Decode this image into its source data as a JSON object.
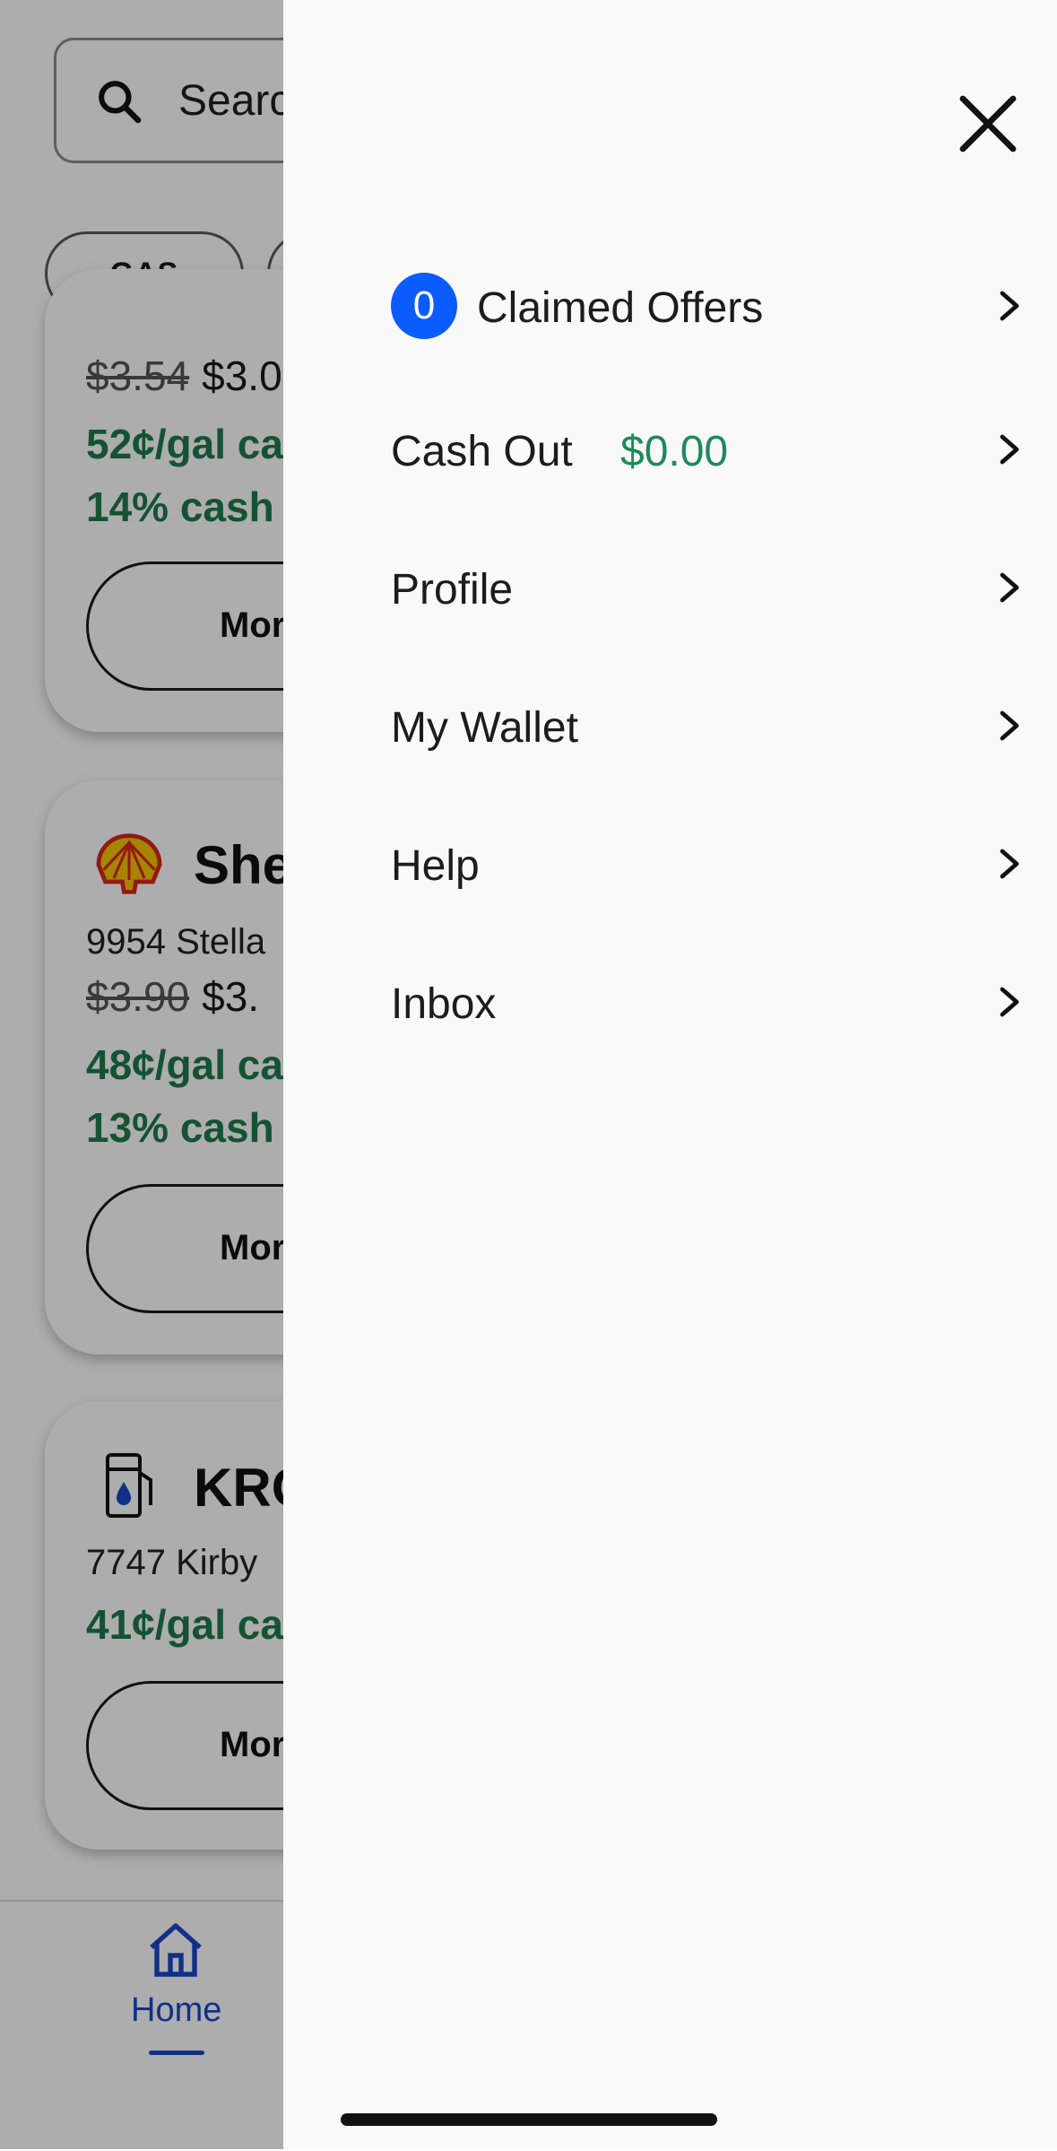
{
  "background": {
    "search": {
      "placeholder": "Search"
    },
    "chips": [
      {
        "label": "GAS"
      }
    ],
    "cards": [
      {
        "old_price": "$3.54",
        "new_price": "$3.0",
        "cashback_line1": "52¢/gal ca",
        "cashback_line2": "14% cash",
        "button_label": "Mor"
      },
      {
        "name": "She",
        "address": "9954 Stella",
        "old_price": "$3.90",
        "new_price": "$3.",
        "cashback_line1": "48¢/gal ca",
        "cashback_line2": "13% cash",
        "button_label": "Mor"
      },
      {
        "name": "KRO",
        "address": "7747 Kirby",
        "cashback_line1": "41¢/gal ca",
        "button_label": "Mor"
      }
    ],
    "bottom_nav": {
      "home_label": "Home"
    }
  },
  "drawer": {
    "claimed_offers_count": "0",
    "items": [
      {
        "label": "Claimed Offers"
      },
      {
        "label": "Cash Out",
        "amount": "$0.00"
      },
      {
        "label": "Profile"
      },
      {
        "label": "My Wallet"
      },
      {
        "label": "Help"
      },
      {
        "label": "Inbox"
      }
    ]
  },
  "colors": {
    "accent_blue": "#0b5cff",
    "cash_green": "#1e8a5a",
    "offer_green": "#1e7a4c",
    "nav_blue": "#1947c8"
  }
}
